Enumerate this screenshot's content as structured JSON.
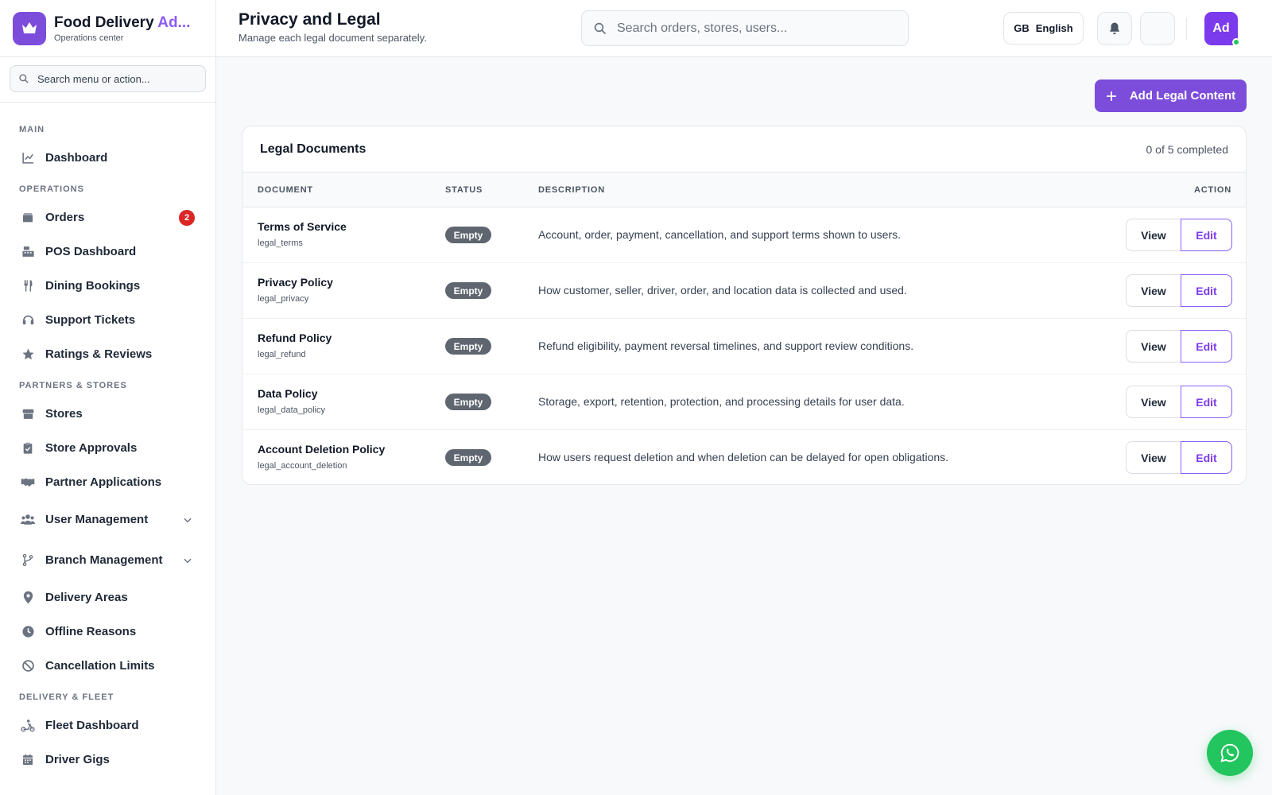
{
  "brand": {
    "title_main": "Food Delivery ",
    "title_accent": "Ad...",
    "subtitle": "Operations center"
  },
  "sidebar": {
    "search_placeholder": "Search menu or action...",
    "sections": [
      {
        "label": "MAIN",
        "items": [
          {
            "label": "Dashboard",
            "icon": "chart-line-icon"
          }
        ]
      },
      {
        "label": "OPERATIONS",
        "items": [
          {
            "label": "Orders",
            "icon": "box-icon",
            "badge": "2"
          },
          {
            "label": "POS Dashboard",
            "icon": "cash-register-icon"
          },
          {
            "label": "Dining Bookings",
            "icon": "utensils-icon"
          },
          {
            "label": "Support Tickets",
            "icon": "headset-icon"
          },
          {
            "label": "Ratings & Reviews",
            "icon": "star-icon"
          }
        ]
      },
      {
        "label": "PARTNERS & STORES",
        "items": [
          {
            "label": "Stores",
            "icon": "store-icon"
          },
          {
            "label": "Store Approvals",
            "icon": "clipboard-check-icon"
          },
          {
            "label": "Partner Applications",
            "icon": "handshake-icon"
          },
          {
            "label": "User Management",
            "icon": "users-icon",
            "expandable": true
          },
          {
            "label": "Branch Management",
            "icon": "branch-icon",
            "expandable": true
          },
          {
            "label": "Delivery Areas",
            "icon": "map-pin-icon"
          },
          {
            "label": "Offline Reasons",
            "icon": "clock-icon"
          },
          {
            "label": "Cancellation Limits",
            "icon": "ban-icon"
          }
        ]
      },
      {
        "label": "DELIVERY & FLEET",
        "items": [
          {
            "label": "Fleet Dashboard",
            "icon": "scooter-icon"
          },
          {
            "label": "Driver Gigs",
            "icon": "calendar-icon"
          }
        ]
      }
    ]
  },
  "header": {
    "title": "Privacy and Legal",
    "subtitle": "Manage each legal document separately.",
    "search_placeholder": "Search orders, stores, users...",
    "language_flag": "GB",
    "language_label": "English",
    "avatar_initials": "Ad"
  },
  "actions": {
    "add_label": "Add Legal Content"
  },
  "card": {
    "title": "Legal Documents",
    "count": "0 of 5 completed",
    "columns": [
      "DOCUMENT",
      "STATUS",
      "DESCRIPTION",
      "ACTION"
    ],
    "view_label": "View",
    "edit_label": "Edit",
    "rows": [
      {
        "name": "Terms of Service",
        "key": "legal_terms",
        "status": "Empty",
        "description": "Account, order, payment, cancellation, and support terms shown to users."
      },
      {
        "name": "Privacy Policy",
        "key": "legal_privacy",
        "status": "Empty",
        "description": "How customer, seller, driver, order, and location data is collected and used."
      },
      {
        "name": "Refund Policy",
        "key": "legal_refund",
        "status": "Empty",
        "description": "Refund eligibility, payment reversal timelines, and support review conditions."
      },
      {
        "name": "Data Policy",
        "key": "legal_data_policy",
        "status": "Empty",
        "description": "Storage, export, retention, protection, and processing details for user data."
      },
      {
        "name": "Account Deletion Policy",
        "key": "legal_account_deletion",
        "status": "Empty",
        "description": "How users request deletion and when deletion can be delayed for open obligations."
      }
    ]
  },
  "colors": {
    "accent": "#7c4ddb",
    "danger": "#dc2626",
    "success": "#22c55e",
    "status_empty": "#5f6670"
  }
}
